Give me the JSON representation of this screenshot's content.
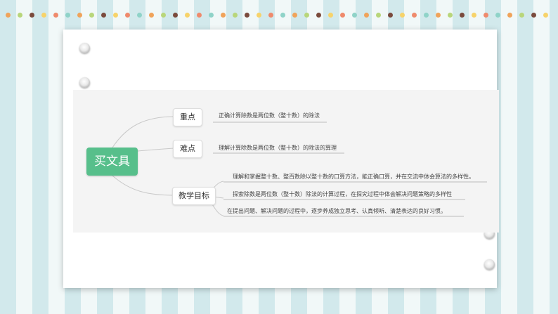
{
  "decor": {
    "dot_colors": [
      "#f0a35a",
      "#b8d67a",
      "#7a4a3c",
      "#f7d36a",
      "#ef8a6c",
      "#8fd3c8"
    ]
  },
  "mindmap": {
    "root": "买文具",
    "branches": [
      {
        "label": "重点",
        "items": [
          "正确计算除数是两位数（整十数）的除法"
        ]
      },
      {
        "label": "难点",
        "items": [
          "理解计算除数是两位数（整十数）的除法的算理"
        ]
      },
      {
        "label": "教学目标",
        "items": [
          "理解和掌握整十数、整百数除以整十数的口算方法，能正确口算，并在交流中体会算法的多样性。",
          "探索除数是两位数（整十数）除法的计算过程，在探究过程中体会解决问题策略的多样性",
          "在提出问题、解决问题的过程中，逐步养成独立思考、认真倾听、清楚表达的良好习惯。"
        ]
      }
    ]
  }
}
